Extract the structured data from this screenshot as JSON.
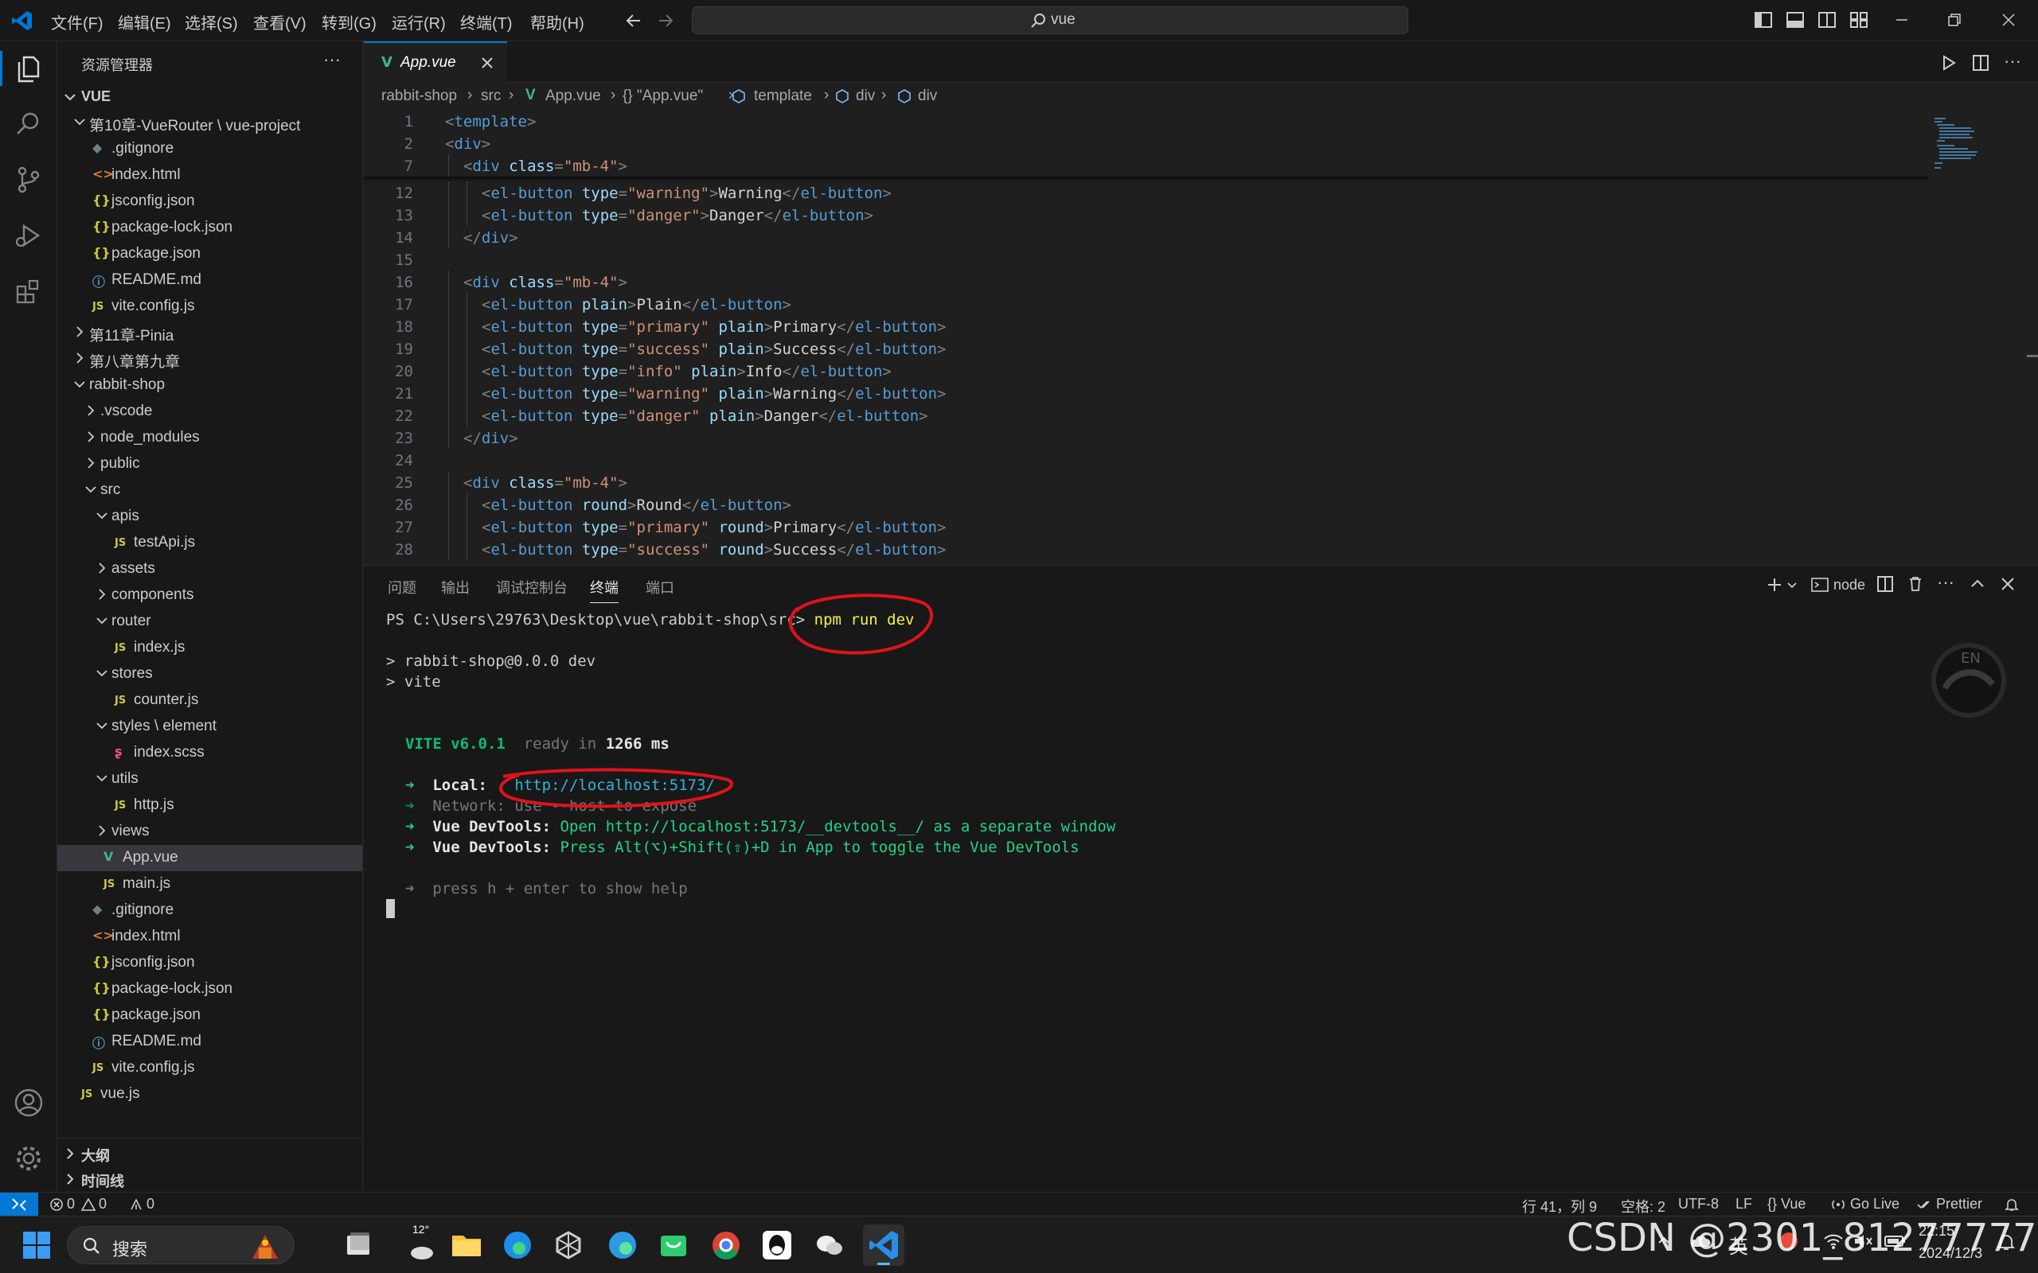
{
  "titlebar": {
    "menu": [
      "文件(F)",
      "编辑(E)",
      "选择(S)",
      "查看(V)",
      "转到(G)",
      "运行(R)",
      "终端(T)",
      "帮助(H)"
    ],
    "search_text": "vue"
  },
  "sidebar": {
    "title": "资源管理器",
    "more": "···",
    "root": "VUE",
    "items": [
      {
        "label": "第10章-VueRouter \\ vue-project",
        "type": "folder-open",
        "depth": 1
      },
      {
        "label": ".gitignore",
        "type": "git",
        "depth": 2
      },
      {
        "label": "index.html",
        "type": "html",
        "depth": 2
      },
      {
        "label": "jsconfig.json",
        "type": "json",
        "depth": 2
      },
      {
        "label": "package-lock.json",
        "type": "json",
        "depth": 2
      },
      {
        "label": "package.json",
        "type": "json",
        "depth": 2
      },
      {
        "label": "README.md",
        "type": "md",
        "depth": 2
      },
      {
        "label": "vite.config.js",
        "type": "js",
        "depth": 2
      },
      {
        "label": "第11章-Pinia",
        "type": "folder",
        "depth": 1
      },
      {
        "label": "第八章第九章",
        "type": "folder",
        "depth": 1
      },
      {
        "label": "rabbit-shop",
        "type": "folder-open",
        "depth": 1
      },
      {
        "label": ".vscode",
        "type": "folder",
        "depth": 2
      },
      {
        "label": "node_modules",
        "type": "folder",
        "depth": 2
      },
      {
        "label": "public",
        "type": "folder",
        "depth": 2
      },
      {
        "label": "src",
        "type": "folder-open",
        "depth": 2
      },
      {
        "label": "apis",
        "type": "folder-open",
        "depth": 3
      },
      {
        "label": "testApi.js",
        "type": "js",
        "depth": 4
      },
      {
        "label": "assets",
        "type": "folder",
        "depth": 3
      },
      {
        "label": "components",
        "type": "folder",
        "depth": 3
      },
      {
        "label": "router",
        "type": "folder-open",
        "depth": 3
      },
      {
        "label": "index.js",
        "type": "js",
        "depth": 4
      },
      {
        "label": "stores",
        "type": "folder-open",
        "depth": 3
      },
      {
        "label": "counter.js",
        "type": "js",
        "depth": 4
      },
      {
        "label": "styles \\ element",
        "type": "folder-open",
        "depth": 3
      },
      {
        "label": "index.scss",
        "type": "scss",
        "depth": 4
      },
      {
        "label": "utils",
        "type": "folder-open",
        "depth": 3
      },
      {
        "label": "http.js",
        "type": "js",
        "depth": 4
      },
      {
        "label": "views",
        "type": "folder",
        "depth": 3
      },
      {
        "label": "App.vue",
        "type": "vue",
        "depth": 3,
        "selected": true
      },
      {
        "label": "main.js",
        "type": "js",
        "depth": 3
      },
      {
        "label": ".gitignore",
        "type": "git",
        "depth": 2
      },
      {
        "label": "index.html",
        "type": "html",
        "depth": 2
      },
      {
        "label": "jsconfig.json",
        "type": "json",
        "depth": 2
      },
      {
        "label": "package-lock.json",
        "type": "json",
        "depth": 2
      },
      {
        "label": "package.json",
        "type": "json",
        "depth": 2
      },
      {
        "label": "README.md",
        "type": "md",
        "depth": 2
      },
      {
        "label": "vite.config.js",
        "type": "js",
        "depth": 2
      },
      {
        "label": "vue.js",
        "type": "js",
        "depth": 1
      }
    ],
    "outline": "大纲",
    "timeline": "时间线"
  },
  "editor": {
    "tab_label": "App.vue",
    "breadcrumb": [
      "rabbit-shop",
      "src",
      "App.vue",
      "{} \"App.vue\"",
      "template",
      "div",
      "div"
    ],
    "lines": [
      {
        "n": "1",
        "code": [
          [
            "pu",
            "<"
          ],
          [
            "tg",
            "template"
          ],
          [
            "pu",
            ">"
          ]
        ],
        "indent": 0
      },
      {
        "n": "2",
        "code": [
          [
            "pu",
            "<"
          ],
          [
            "tg",
            "div"
          ],
          [
            "pu",
            ">"
          ]
        ],
        "indent": 0
      },
      {
        "n": "7",
        "code": [
          [
            "pu",
            "<"
          ],
          [
            "tg",
            "div "
          ],
          [
            "at",
            "class"
          ],
          [
            "pu",
            "="
          ],
          [
            "st",
            "\"mb-4\""
          ],
          [
            "pu",
            ">"
          ]
        ],
        "indent": 1
      },
      {
        "n": "12",
        "code": [
          [
            "pu",
            "<"
          ],
          [
            "tg",
            "el-button "
          ],
          [
            "at",
            "type"
          ],
          [
            "pu",
            "="
          ],
          [
            "st",
            "\"warning\""
          ],
          [
            "pu",
            ">"
          ],
          [
            "tx",
            "Warning"
          ],
          [
            "pu",
            "</"
          ],
          [
            "tg",
            "el-button"
          ],
          [
            "pu",
            ">"
          ]
        ],
        "indent": 2
      },
      {
        "n": "13",
        "code": [
          [
            "pu",
            "<"
          ],
          [
            "tg",
            "el-button "
          ],
          [
            "at",
            "type"
          ],
          [
            "pu",
            "="
          ],
          [
            "st",
            "\"danger\""
          ],
          [
            "pu",
            ">"
          ],
          [
            "tx",
            "Danger"
          ],
          [
            "pu",
            "</"
          ],
          [
            "tg",
            "el-button"
          ],
          [
            "pu",
            ">"
          ]
        ],
        "indent": 2
      },
      {
        "n": "14",
        "code": [
          [
            "pu",
            "</"
          ],
          [
            "tg",
            "div"
          ],
          [
            "pu",
            ">"
          ]
        ],
        "indent": 1
      },
      {
        "n": "15",
        "code": [],
        "indent": 0
      },
      {
        "n": "16",
        "code": [
          [
            "pu",
            "<"
          ],
          [
            "tg",
            "div "
          ],
          [
            "at",
            "class"
          ],
          [
            "pu",
            "="
          ],
          [
            "st",
            "\"mb-4\""
          ],
          [
            "pu",
            ">"
          ]
        ],
        "indent": 1
      },
      {
        "n": "17",
        "code": [
          [
            "pu",
            "<"
          ],
          [
            "tg",
            "el-button "
          ],
          [
            "at",
            "plain"
          ],
          [
            "pu",
            ">"
          ],
          [
            "tx",
            "Plain"
          ],
          [
            "pu",
            "</"
          ],
          [
            "tg",
            "el-button"
          ],
          [
            "pu",
            ">"
          ]
        ],
        "indent": 2
      },
      {
        "n": "18",
        "code": [
          [
            "pu",
            "<"
          ],
          [
            "tg",
            "el-button "
          ],
          [
            "at",
            "type"
          ],
          [
            "pu",
            "="
          ],
          [
            "st",
            "\"primary\" "
          ],
          [
            "at",
            "plain"
          ],
          [
            "pu",
            ">"
          ],
          [
            "tx",
            "Primary"
          ],
          [
            "pu",
            "</"
          ],
          [
            "tg",
            "el-button"
          ],
          [
            "pu",
            ">"
          ]
        ],
        "indent": 2
      },
      {
        "n": "19",
        "code": [
          [
            "pu",
            "<"
          ],
          [
            "tg",
            "el-button "
          ],
          [
            "at",
            "type"
          ],
          [
            "pu",
            "="
          ],
          [
            "st",
            "\"success\" "
          ],
          [
            "at",
            "plain"
          ],
          [
            "pu",
            ">"
          ],
          [
            "tx",
            "Success"
          ],
          [
            "pu",
            "</"
          ],
          [
            "tg",
            "el-button"
          ],
          [
            "pu",
            ">"
          ]
        ],
        "indent": 2
      },
      {
        "n": "20",
        "code": [
          [
            "pu",
            "<"
          ],
          [
            "tg",
            "el-button "
          ],
          [
            "at",
            "type"
          ],
          [
            "pu",
            "="
          ],
          [
            "st",
            "\"info\" "
          ],
          [
            "at",
            "plain"
          ],
          [
            "pu",
            ">"
          ],
          [
            "tx",
            "Info"
          ],
          [
            "pu",
            "</"
          ],
          [
            "tg",
            "el-button"
          ],
          [
            "pu",
            ">"
          ]
        ],
        "indent": 2
      },
      {
        "n": "21",
        "code": [
          [
            "pu",
            "<"
          ],
          [
            "tg",
            "el-button "
          ],
          [
            "at",
            "type"
          ],
          [
            "pu",
            "="
          ],
          [
            "st",
            "\"warning\" "
          ],
          [
            "at",
            "plain"
          ],
          [
            "pu",
            ">"
          ],
          [
            "tx",
            "Warning"
          ],
          [
            "pu",
            "</"
          ],
          [
            "tg",
            "el-button"
          ],
          [
            "pu",
            ">"
          ]
        ],
        "indent": 2
      },
      {
        "n": "22",
        "code": [
          [
            "pu",
            "<"
          ],
          [
            "tg",
            "el-button "
          ],
          [
            "at",
            "type"
          ],
          [
            "pu",
            "="
          ],
          [
            "st",
            "\"danger\" "
          ],
          [
            "at",
            "plain"
          ],
          [
            "pu",
            ">"
          ],
          [
            "tx",
            "Danger"
          ],
          [
            "pu",
            "</"
          ],
          [
            "tg",
            "el-button"
          ],
          [
            "pu",
            ">"
          ]
        ],
        "indent": 2
      },
      {
        "n": "23",
        "code": [
          [
            "pu",
            "</"
          ],
          [
            "tg",
            "div"
          ],
          [
            "pu",
            ">"
          ]
        ],
        "indent": 1
      },
      {
        "n": "24",
        "code": [],
        "indent": 0
      },
      {
        "n": "25",
        "code": [
          [
            "pu",
            "<"
          ],
          [
            "tg",
            "div "
          ],
          [
            "at",
            "class"
          ],
          [
            "pu",
            "="
          ],
          [
            "st",
            "\"mb-4\""
          ],
          [
            "pu",
            ">"
          ]
        ],
        "indent": 1
      },
      {
        "n": "26",
        "code": [
          [
            "pu",
            "<"
          ],
          [
            "tg",
            "el-button "
          ],
          [
            "at",
            "round"
          ],
          [
            "pu",
            ">"
          ],
          [
            "tx",
            "Round"
          ],
          [
            "pu",
            "</"
          ],
          [
            "tg",
            "el-button"
          ],
          [
            "pu",
            ">"
          ]
        ],
        "indent": 2
      },
      {
        "n": "27",
        "code": [
          [
            "pu",
            "<"
          ],
          [
            "tg",
            "el-button "
          ],
          [
            "at",
            "type"
          ],
          [
            "pu",
            "="
          ],
          [
            "st",
            "\"primary\" "
          ],
          [
            "at",
            "round"
          ],
          [
            "pu",
            ">"
          ],
          [
            "tx",
            "Primary"
          ],
          [
            "pu",
            "</"
          ],
          [
            "tg",
            "el-button"
          ],
          [
            "pu",
            ">"
          ]
        ],
        "indent": 2
      },
      {
        "n": "28",
        "code": [
          [
            "pu",
            "<"
          ],
          [
            "tg",
            "el-button "
          ],
          [
            "at",
            "type"
          ],
          [
            "pu",
            "="
          ],
          [
            "st",
            "\"success\" "
          ],
          [
            "at",
            "round"
          ],
          [
            "pu",
            ">"
          ],
          [
            "tx",
            "Success"
          ],
          [
            "pu",
            "</"
          ],
          [
            "tg",
            "el-button"
          ],
          [
            "pu",
            ">"
          ]
        ],
        "indent": 2
      }
    ]
  },
  "panel": {
    "tabs": [
      "问题",
      "输出",
      "调试控制台",
      "终端",
      "端口"
    ],
    "active_tab": "终端",
    "shell_label": "node",
    "terminal": {
      "prompt": "PS C:\\Users\\29763\\Desktop\\vue\\rabbit-shop\\src> ",
      "command": "npm run dev",
      "script_line1": "> rabbit-shop@0.0.0 dev",
      "script_line2": "> vite",
      "vite_name": "VITE v6.0.1",
      "ready_text": "ready in ",
      "ready_ms": "1266 ms",
      "local_label": "Local:",
      "local_url": "http://localhost:5173/",
      "network_label": "Network:",
      "network_text": "use --host to expose",
      "devtools_label": "Vue DevTools:",
      "devtools_line1": "Open http://localhost:5173/__devtools__/ as a separate window",
      "devtools_line2": "Press Alt(⌥)+Shift(⇧)+D in App to toggle the Vue DevTools",
      "help_text": "press h + enter to show help",
      "arrow": "➜"
    }
  },
  "statusbar": {
    "errors": "0",
    "warnings": "0",
    "ports": "0",
    "position": "行 41，列 9",
    "spaces": "空格: 2",
    "encoding": "UTF-8",
    "eol": "LF",
    "language": "{} Vue",
    "golive": "Go Live",
    "prettier": "Prettier"
  },
  "taskbar": {
    "search_placeholder": "搜索",
    "weather": "12°",
    "ime": "英",
    "time": "22:15",
    "date": "2024/12/3"
  },
  "watermark": "CSDN @2301_81277777",
  "colors": {
    "accent": "#0078d4",
    "annotation_red": "#e0121b"
  }
}
